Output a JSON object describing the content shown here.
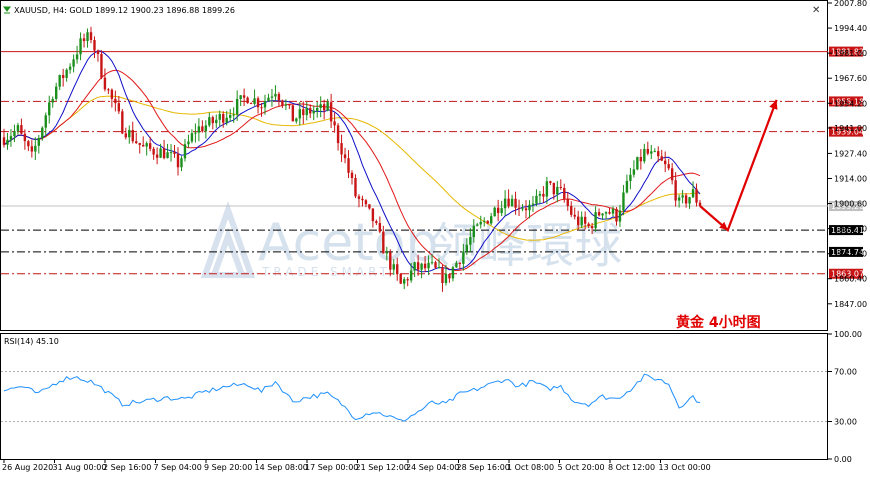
{
  "header": {
    "symbol_info": "XAUUSD, H4:  GOLD  1899.12 1900.23 1896.88 1899.26",
    "window_close_icon": "close-icon"
  },
  "watermark": {
    "brand_en": "Acetop",
    "brand_zh": "领峰環球",
    "sub": "TRADE SMART"
  },
  "annotation": {
    "text": "黄金  4小时图",
    "color": "#e00000"
  },
  "colors": {
    "bull": "#1b8f1b",
    "bear": "#c81414",
    "ma_fast": "#1010c8",
    "ma_mid": "#e01818",
    "ma_slow": "#e6b800",
    "rsi": "#1e90ff",
    "resistance": "#c81414",
    "support": "#000000"
  },
  "chart_data": [
    {
      "type": "candlestick",
      "symbol": "XAUUSD",
      "timeframe": "H4",
      "ylim": [
        1833,
        2007.8
      ],
      "y_ticks": [
        "2007.80",
        "1994.40",
        "1981.00",
        "1967.60",
        "1954.20",
        "1941.00",
        "1927.40",
        "1914.00",
        "1900.60",
        "1887.20",
        "1873.80",
        "1860.40",
        "1847.00"
      ],
      "x_labels": [
        "26 Aug 2020",
        "31 Aug 00:00",
        "2 Sep 16:00",
        "7 Sep 04:00",
        "9 Sep 20:00",
        "14 Sep 08:00",
        "17 Sep 00:00",
        "21 Sep 12:00",
        "24 Sep 04:00",
        "28 Sep 16:00",
        "1 Oct 08:00",
        "5 Oct 20:00",
        "8 Oct 12:00",
        "13 Oct 00:00"
      ],
      "current_price": {
        "value": 1899.26,
        "label": "1899.26"
      },
      "levels": [
        {
          "value": 1981.82,
          "label": "1981.82",
          "style": "solid",
          "color": "#c81414"
        },
        {
          "value": 1955.18,
          "label": "1955.18",
          "style": "dashdot",
          "color": "#c81414"
        },
        {
          "value": 1939.04,
          "label": "1939.04",
          "style": "dashdot",
          "color": "#c81414"
        },
        {
          "value": 1886.41,
          "label": "1886.41",
          "style": "dashdot",
          "color": "#000000"
        },
        {
          "value": 1874.74,
          "label": "1874.74",
          "style": "dashdot",
          "color": "#000000"
        },
        {
          "value": 1863.07,
          "label": "1863.07",
          "style": "dashdot",
          "color": "#c81414"
        }
      ],
      "anchors": [
        [
          0,
          1936
        ],
        [
          4,
          1940
        ],
        [
          8,
          1925
        ],
        [
          14,
          1960
        ],
        [
          18,
          1972
        ],
        [
          22,
          1986
        ],
        [
          25,
          1990
        ],
        [
          29,
          1965
        ],
        [
          34,
          1942
        ],
        [
          40,
          1930
        ],
        [
          46,
          1928
        ],
        [
          50,
          1922
        ],
        [
          55,
          1940
        ],
        [
          60,
          1944
        ],
        [
          65,
          1950
        ],
        [
          70,
          1958
        ],
        [
          74,
          1954
        ],
        [
          78,
          1962
        ],
        [
          83,
          1946
        ],
        [
          88,
          1950
        ],
        [
          93,
          1951
        ],
        [
          97,
          1930
        ],
        [
          101,
          1905
        ],
        [
          106,
          1892
        ],
        [
          110,
          1872
        ],
        [
          114,
          1857
        ],
        [
          118,
          1866
        ],
        [
          123,
          1866
        ],
        [
          127,
          1860
        ],
        [
          131,
          1872
        ],
        [
          135,
          1885
        ],
        [
          140,
          1895
        ],
        [
          144,
          1904
        ],
        [
          148,
          1900
        ],
        [
          152,
          1898
        ],
        [
          156,
          1910
        ],
        [
          160,
          1906
        ],
        [
          164,
          1892
        ],
        [
          168,
          1888
        ],
        [
          172,
          1898
        ],
        [
          176,
          1894
        ],
        [
          180,
          1915
        ],
        [
          184,
          1928
        ],
        [
          188,
          1924
        ],
        [
          191,
          1918
        ],
        [
          194,
          1900
        ],
        [
          198,
          1906
        ],
        [
          200,
          1899.26
        ]
      ],
      "projection": [
        [
          200,
          1899.26
        ],
        [
          208,
          1886.41
        ],
        [
          222,
          1956
        ]
      ]
    },
    {
      "type": "line",
      "name": "RSI(14)",
      "label": "RSI(14) 45.10",
      "ylim": [
        0,
        100
      ],
      "y_ticks": [
        "100.00",
        "70.00",
        "30.00",
        "0.00"
      ],
      "levels": [
        70,
        30
      ],
      "anchors": [
        [
          0,
          55
        ],
        [
          5,
          58
        ],
        [
          10,
          52
        ],
        [
          16,
          63
        ],
        [
          20,
          66
        ],
        [
          25,
          62
        ],
        [
          29,
          55
        ],
        [
          34,
          44
        ],
        [
          40,
          46
        ],
        [
          46,
          49
        ],
        [
          52,
          48
        ],
        [
          58,
          54
        ],
        [
          64,
          58
        ],
        [
          70,
          60
        ],
        [
          74,
          54
        ],
        [
          78,
          62
        ],
        [
          83,
          46
        ],
        [
          88,
          50
        ],
        [
          93,
          52
        ],
        [
          97,
          44
        ],
        [
          101,
          33
        ],
        [
          106,
          38
        ],
        [
          110,
          35
        ],
        [
          114,
          30
        ],
        [
          118,
          36
        ],
        [
          123,
          45
        ],
        [
          127,
          44
        ],
        [
          131,
          52
        ],
        [
          135,
          55
        ],
        [
          140,
          60
        ],
        [
          144,
          64
        ],
        [
          148,
          58
        ],
        [
          152,
          62
        ],
        [
          156,
          56
        ],
        [
          160,
          58
        ],
        [
          164,
          46
        ],
        [
          168,
          44
        ],
        [
          172,
          50
        ],
        [
          176,
          48
        ],
        [
          180,
          56
        ],
        [
          184,
          66
        ],
        [
          188,
          64
        ],
        [
          191,
          60
        ],
        [
          194,
          42
        ],
        [
          198,
          50
        ],
        [
          200,
          45.1
        ]
      ]
    }
  ]
}
